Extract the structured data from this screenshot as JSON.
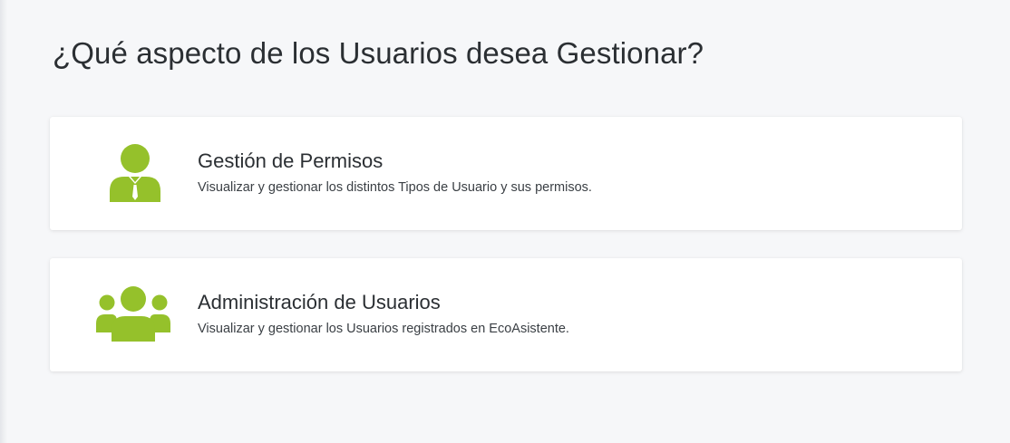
{
  "page": {
    "title": "¿Qué aspecto de los Usuarios desea Gestionar?"
  },
  "colors": {
    "accent": "#95c12b",
    "background": "#f6f7f9",
    "card": "#ffffff",
    "text": "#2b2f33"
  },
  "options": [
    {
      "icon": "user-tie-icon",
      "title": "Gestión de Permisos",
      "description": "Visualizar y gestionar los distintos Tipos de Usuario y sus permisos."
    },
    {
      "icon": "users-group-icon",
      "title": "Administración de Usuarios",
      "description": "Visualizar y gestionar los Usuarios registrados en EcoAsistente."
    }
  ]
}
